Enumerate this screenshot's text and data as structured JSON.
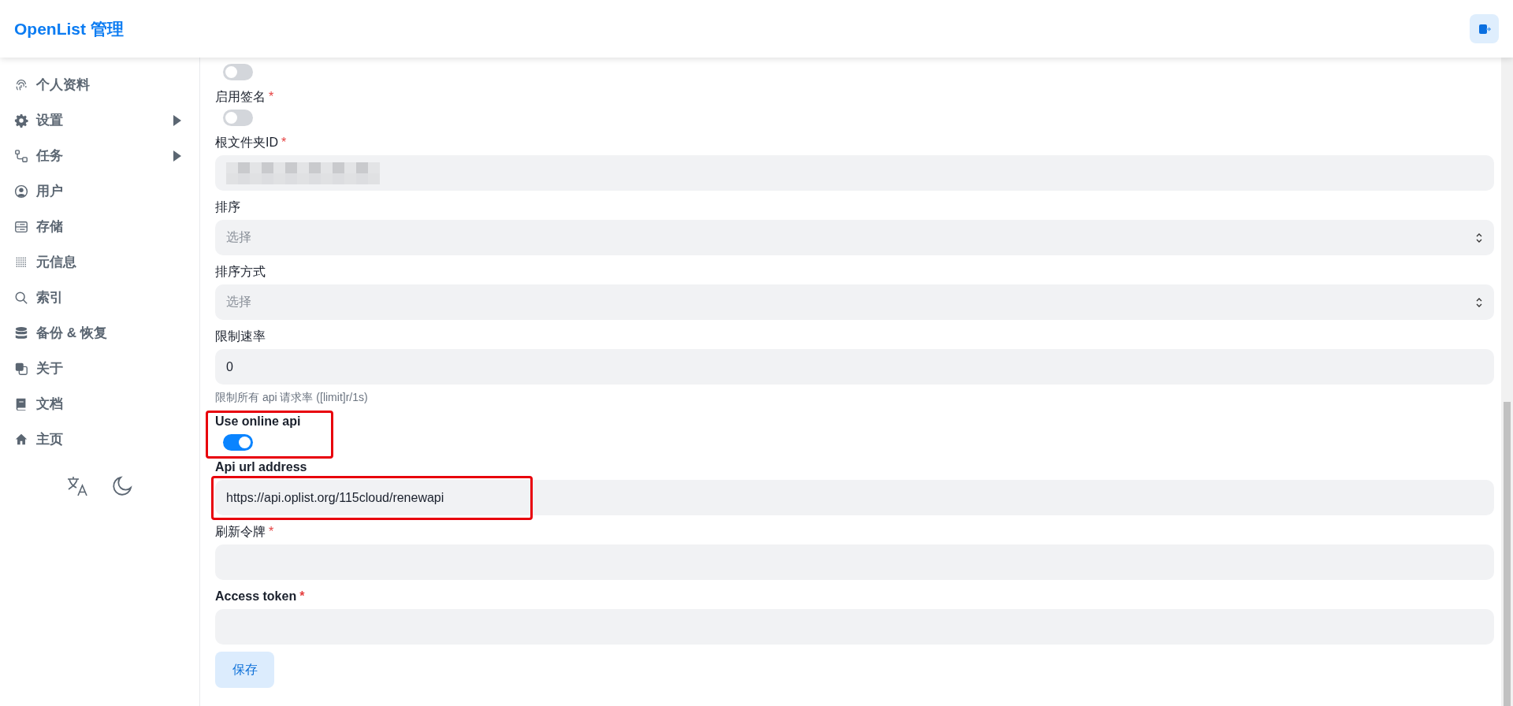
{
  "header": {
    "title": "OpenList 管理"
  },
  "sidebar": {
    "items": [
      {
        "kind": "fingerprint",
        "label": "个人资料",
        "expandable": false
      },
      {
        "kind": "gear",
        "label": "设置",
        "expandable": true
      },
      {
        "kind": "flow",
        "label": "任务",
        "expandable": true
      },
      {
        "kind": "user",
        "label": "用户",
        "expandable": false
      },
      {
        "kind": "storage",
        "label": "存储",
        "expandable": false
      },
      {
        "kind": "dots",
        "label": "元信息",
        "expandable": false
      },
      {
        "kind": "search",
        "label": "索引",
        "expandable": false
      },
      {
        "kind": "database",
        "label": "备份 & 恢复",
        "expandable": false
      },
      {
        "kind": "squares",
        "label": "关于",
        "expandable": false
      },
      {
        "kind": "book",
        "label": "文档",
        "expandable": false
      },
      {
        "kind": "home",
        "label": "主页",
        "expandable": false
      }
    ]
  },
  "form": {
    "fields": [
      {
        "kind": "toggle",
        "on": false,
        "highlighted": false
      },
      {
        "kind": "toggle",
        "label": "启用签名",
        "required_mark": "*",
        "on": false,
        "highlighted": false
      },
      {
        "kind": "text",
        "label": "根文件夹ID",
        "required_mark": "*",
        "redacted": true,
        "highlighted": false
      },
      {
        "kind": "select",
        "label": "排序",
        "placeholder": "选择",
        "highlighted": false
      },
      {
        "kind": "select",
        "label": "排序方式",
        "placeholder": "选择",
        "highlighted": false
      },
      {
        "kind": "text",
        "label": "限制速率",
        "value": "0",
        "help": "限制所有 api 请求率 ([limit]r/1s)",
        "highlighted": false
      },
      {
        "kind": "toggle",
        "label": "Use online api",
        "on": true,
        "highlighted": true
      },
      {
        "kind": "text",
        "label": "Api url address",
        "value": "https://api.oplist.org/115cloud/renewapi",
        "highlighted": true
      },
      {
        "kind": "text",
        "label": "刷新令牌",
        "required_mark": "*",
        "highlighted": false
      },
      {
        "kind": "text",
        "label": "Access token",
        "required_mark": "*",
        "highlighted": false
      }
    ],
    "save_button": "保存"
  }
}
